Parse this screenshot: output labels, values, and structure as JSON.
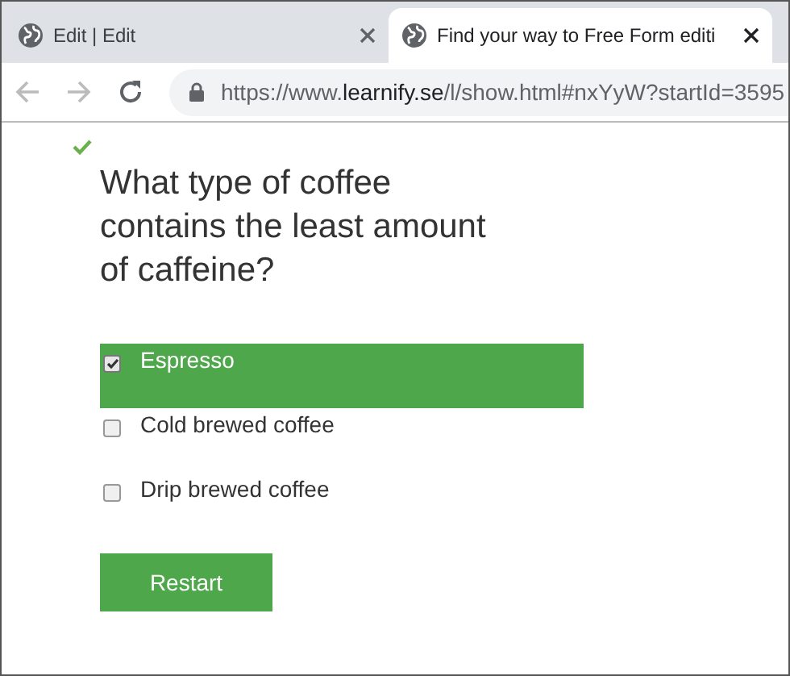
{
  "tabs": [
    {
      "title": "Edit | Edit",
      "selected": false
    },
    {
      "title": "Find your way to Free Form editi",
      "selected": true
    }
  ],
  "address_bar": {
    "scheme": "https://www.",
    "host": "learnify.se",
    "path": "/l/show.html#nxYyW?startId=3595"
  },
  "quiz": {
    "answered_correctly": true,
    "question": "What type of coffee contains the least amount of caffeine?",
    "answers": [
      {
        "label": "Espresso",
        "checked": true,
        "selected": true
      },
      {
        "label": "Cold brewed coffee",
        "checked": false,
        "selected": false
      },
      {
        "label": "Drip brewed coffee",
        "checked": false,
        "selected": false
      }
    ],
    "button": "Restart"
  }
}
